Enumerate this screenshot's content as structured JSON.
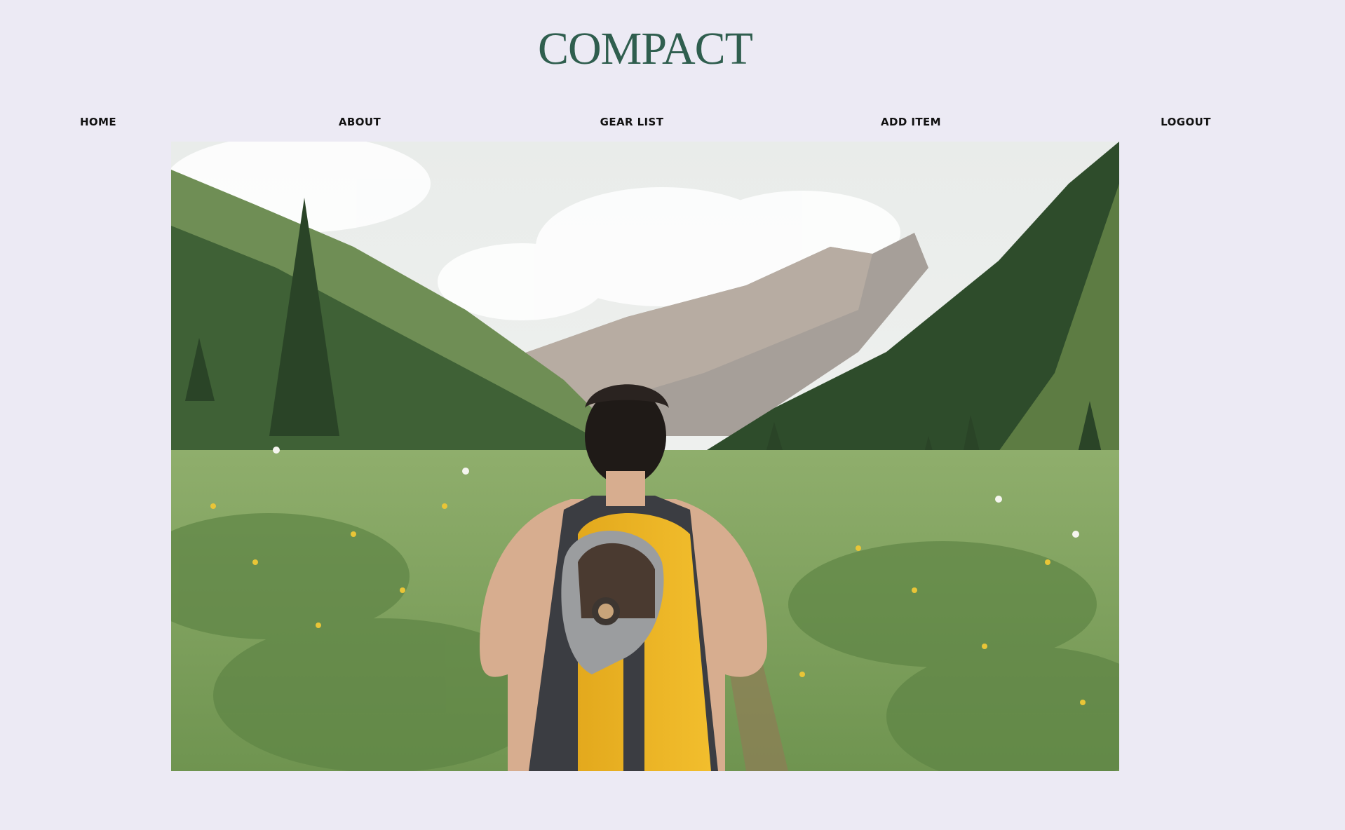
{
  "brand": {
    "name": "COMPACT",
    "color": "#2f5e4e"
  },
  "nav": {
    "items": [
      {
        "label": "HOME"
      },
      {
        "label": "ABOUT"
      },
      {
        "label": "GEAR LIST"
      },
      {
        "label": "ADD ITEM"
      },
      {
        "label": "LOGOUT"
      }
    ]
  },
  "hero": {
    "subject": "hiker-with-yellow-backpack-in-mountain-valley"
  },
  "colors": {
    "background": "#eceaf4",
    "nav_text": "#111111"
  }
}
